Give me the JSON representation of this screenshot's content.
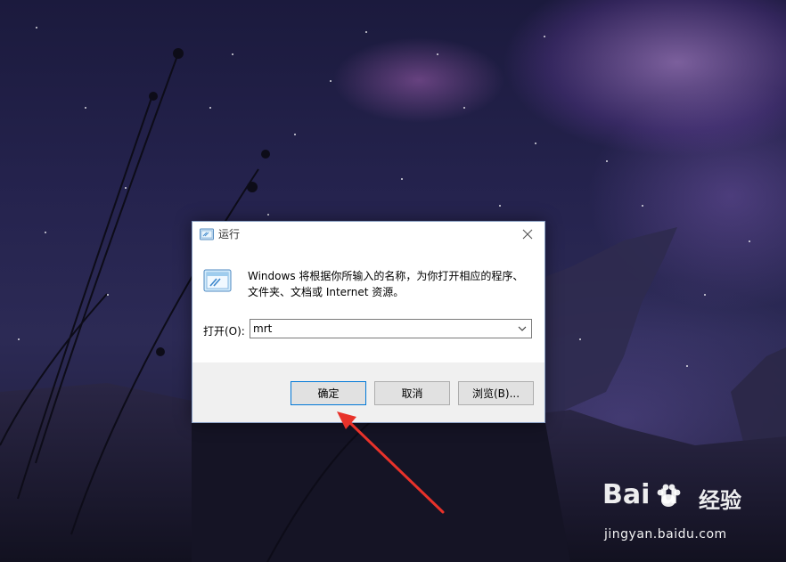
{
  "dialog": {
    "title": "运行",
    "description": "Windows 将根据你所输入的名称，为你打开相应的程序、文件夹、文档或 Internet 资源。",
    "open_label": "打开(O):",
    "open_value": "mrt",
    "ok_label": "确定",
    "cancel_label": "取消",
    "browse_label": "浏览(B)..."
  },
  "watermark": {
    "logo": "Bai  u",
    "brand": "经验",
    "url": "jingyan.baidu.com"
  },
  "colors": {
    "accent": "#0078d7",
    "annotation_arrow": "#e8322a"
  },
  "icons": {
    "run_icon": "run-app-icon",
    "close": "close-icon",
    "combo": "chevron-down-icon",
    "paw": "baidu-paw-icon"
  }
}
